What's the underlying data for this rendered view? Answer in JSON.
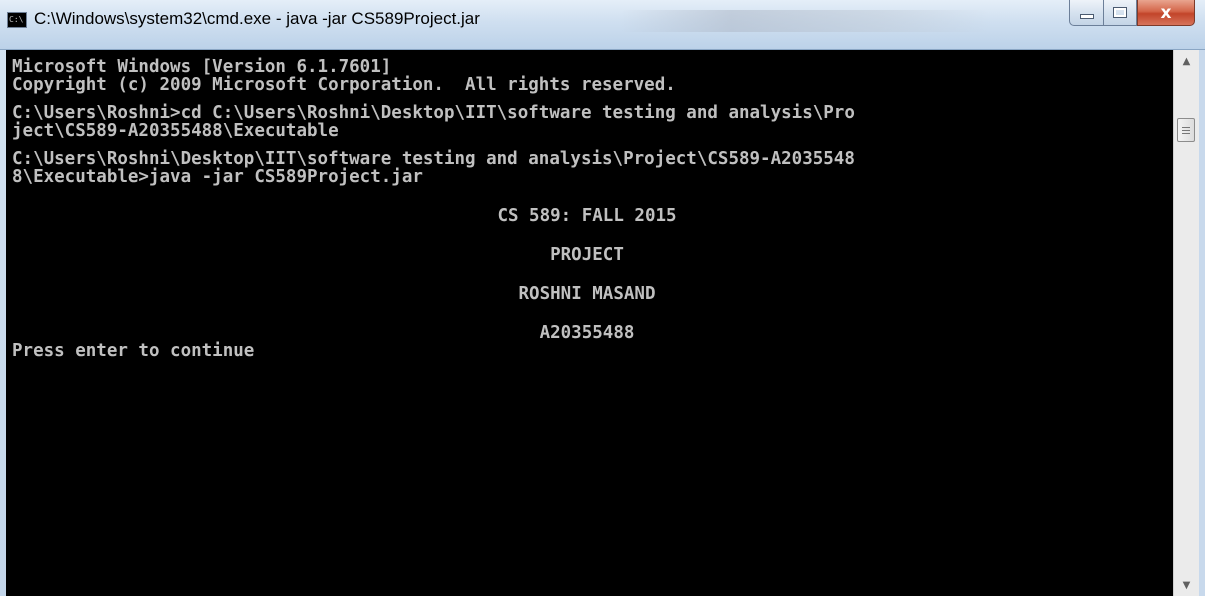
{
  "window": {
    "title": "C:\\Windows\\system32\\cmd.exe - java  -jar CS589Project.jar",
    "icon_label": "C:\\"
  },
  "console": {
    "lines": [
      "Microsoft Windows [Version 6.1.7601]",
      "Copyright (c) 2009 Microsoft Corporation.  All rights reserved.",
      "",
      "C:\\Users\\Roshni>cd C:\\Users\\Roshni\\Desktop\\IIT\\software testing and analysis\\Pro",
      "ject\\CS589-A20355488\\Executable",
      "",
      "C:\\Users\\Roshni\\Desktop\\IIT\\software testing and analysis\\Project\\CS589-A2035548",
      "8\\Executable>java -jar CS589Project.jar"
    ],
    "banner": {
      "course": "CS 589: FALL 2015",
      "project": "PROJECT",
      "name": "ROSHNI MASAND",
      "id": "A20355488"
    },
    "prompt": "Press enter to continue"
  },
  "colors": {
    "console_bg": "#000000",
    "console_text": "#c0c0c0",
    "close_button": "#c2452a"
  },
  "icons": {
    "app": "cmd-icon",
    "minimize": "minimize-icon",
    "maximize": "maximize-icon",
    "close": "close-icon",
    "scroll_up": "arrow-up-icon",
    "scroll_down": "arrow-down-icon"
  },
  "caption": {
    "close_glyph": "x"
  }
}
